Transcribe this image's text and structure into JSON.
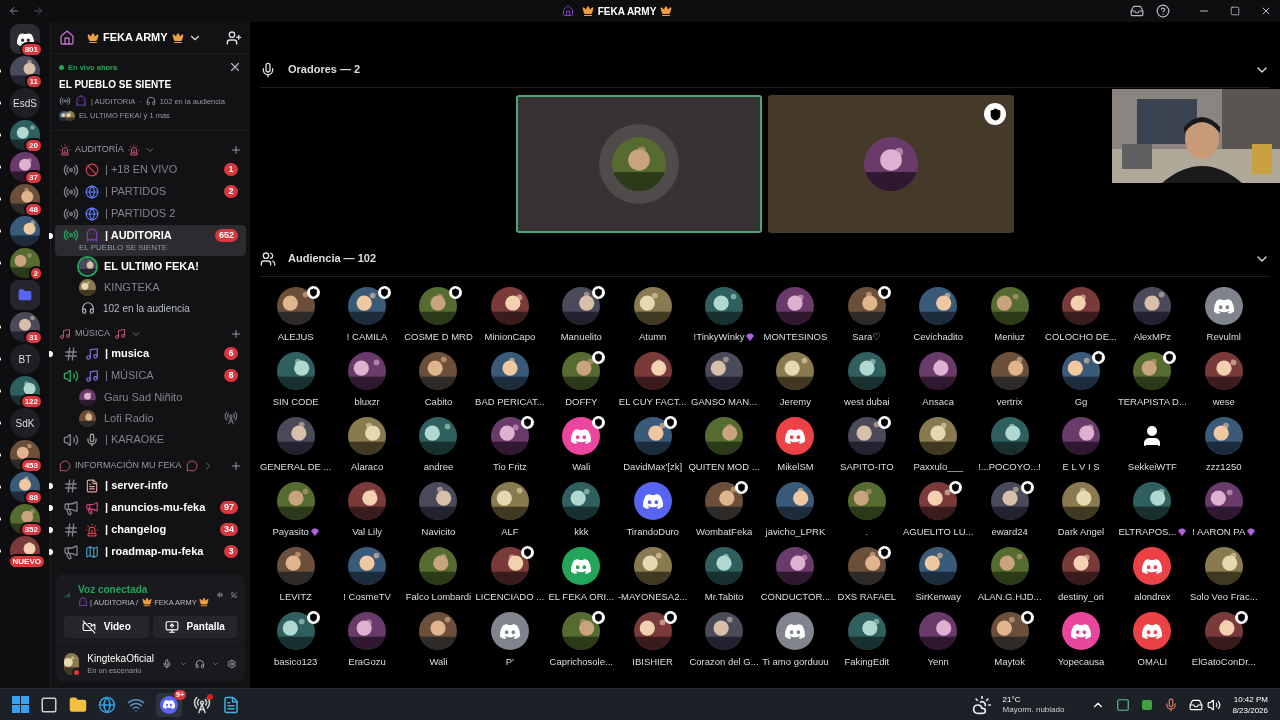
{
  "titlebar": {
    "server_name": "FEKA ARMY"
  },
  "servers": [
    {
      "kind": "discord",
      "badge": "801",
      "unread": false
    },
    {
      "kind": "picture",
      "badge": "11",
      "unread": true
    },
    {
      "kind": "text",
      "label": "EsdS",
      "unread": true
    },
    {
      "kind": "picture",
      "badge": "20",
      "unread": true
    },
    {
      "kind": "picture",
      "badge": "37",
      "unread": true
    },
    {
      "kind": "picture",
      "badge": "48",
      "unread": true
    },
    {
      "kind": "picture",
      "unread": true
    },
    {
      "kind": "picture",
      "badge": "2",
      "unread": true
    },
    {
      "kind": "folder",
      "unread": false
    },
    {
      "kind": "picture",
      "badge": "31",
      "unread": true
    },
    {
      "kind": "text",
      "label": "BT",
      "unread": true
    },
    {
      "kind": "picture",
      "badge": "122",
      "unread": true
    },
    {
      "kind": "text",
      "label": "SdK",
      "unread": true
    },
    {
      "kind": "picture",
      "badge": "453",
      "unread": true
    },
    {
      "kind": "picture",
      "badge": "88",
      "unread": true
    },
    {
      "kind": "picture",
      "badge": "352",
      "unread": true
    },
    {
      "kind": "picture",
      "badge": "NUEVO",
      "unread": true
    }
  ],
  "sidebar": {
    "server_name": "FEKA ARMY",
    "live": {
      "status": "En vivo ahora",
      "title": "EL PUEBLO SE SIENTE",
      "channel": "| AUDITORIA",
      "separator": "·",
      "audience": "102 en la audiencia",
      "speakers": "EL ULTIMO FEKA! y 1 más"
    },
    "categories": [
      {
        "name": "AUDITORÍA",
        "expanded": true,
        "items": [
          {
            "kind": "stage",
            "name": "| +18 EN VIVO",
            "badge": "1",
            "unread": false,
            "selected": false,
            "connected": false
          },
          {
            "kind": "stage",
            "name": "| PARTIDOS",
            "badge": "2",
            "unread": false,
            "selected": false,
            "connected": false
          },
          {
            "kind": "stage",
            "name": "| PARTIDOS 2",
            "unread": false,
            "selected": false,
            "connected": false
          },
          {
            "kind": "stage",
            "name": "| AUDITORIA",
            "badge": "652",
            "subtitle": "EL PUEBLO SE SIENTE",
            "unread": true,
            "selected": true,
            "connected": true
          },
          {
            "kind": "member",
            "name": "EL ULTIMO FEKA!",
            "speaking": true,
            "broadcast_off": false
          },
          {
            "kind": "member",
            "name": "KINGTEKA",
            "speaking": false,
            "broadcast_off": false
          },
          {
            "kind": "audience",
            "name": "102 en la audiencia"
          }
        ]
      },
      {
        "name": "MÚSICA",
        "expanded": true,
        "items": [
          {
            "kind": "text",
            "name": "| musica",
            "badge": "6",
            "unread": true,
            "selected": false,
            "connected": false
          },
          {
            "kind": "voice",
            "name": "| MÚSICA",
            "badge": "8",
            "unread": false,
            "selected": false,
            "connected": true
          },
          {
            "kind": "member",
            "name": "Garu Sad Niñito",
            "speaking": false,
            "broadcast_off": false
          },
          {
            "kind": "member",
            "name": "Lofi Radio",
            "speaking": false,
            "broadcast_off": true
          },
          {
            "kind": "voice",
            "name": "| KARAOKE",
            "unread": false,
            "selected": false,
            "connected": false
          }
        ]
      },
      {
        "name": "INFORMACIÓN MU FEKA",
        "expanded": false,
        "items": [
          {
            "kind": "text",
            "name": "| server-info",
            "unread": true,
            "selected": false,
            "connected": false
          },
          {
            "kind": "announce",
            "name": "| anuncios-mu-feka",
            "badge": "97",
            "unread": true,
            "selected": false,
            "connected": false
          },
          {
            "kind": "text",
            "name": "| changelog",
            "badge": "34",
            "unread": true,
            "selected": false,
            "connected": false
          },
          {
            "kind": "announce",
            "name": "| roadmap-mu-feka",
            "badge": "3",
            "unread": true,
            "selected": false,
            "connected": false
          }
        ]
      }
    ]
  },
  "voice_panel": {
    "status": "Voz conectada",
    "location": "| AUDITORIA / ",
    "server": "FEKA ARMY",
    "buttons": [
      "Video",
      "Pantalla"
    ]
  },
  "user": {
    "name": "KingtekaOficial",
    "status": "En un escenario"
  },
  "main": {
    "speakers_header": "Oradores — 2",
    "speakers": [
      {
        "speaking": true,
        "moderator": false
      },
      {
        "speaking": false,
        "moderator": true
      }
    ],
    "audience_header": "Audiencia — 102",
    "audience": [
      {
        "name": "ALEJUS",
        "kind": "picture",
        "moderator": true,
        "boost": false
      },
      {
        "name": "! CAMILA",
        "kind": "picture",
        "moderator": true,
        "boost": false
      },
      {
        "name": "COSME D MRD",
        "kind": "picture",
        "moderator": true,
        "boost": false
      },
      {
        "name": "MinionCapo",
        "kind": "picture",
        "moderator": false,
        "boost": false
      },
      {
        "name": "Manuelito",
        "kind": "picture",
        "moderator": true,
        "boost": false
      },
      {
        "name": "Atumn",
        "kind": "picture",
        "moderator": false,
        "boost": false
      },
      {
        "name": "!TinkyWinky",
        "kind": "picture",
        "moderator": false,
        "boost": true
      },
      {
        "name": "MONTESINOS",
        "kind": "picture",
        "moderator": false,
        "boost": false
      },
      {
        "name": "Sara♡",
        "kind": "picture",
        "moderator": true,
        "boost": false
      },
      {
        "name": "Cevichadito",
        "kind": "picture",
        "moderator": false,
        "boost": false
      },
      {
        "name": "Meniuz",
        "kind": "picture",
        "moderator": false,
        "boost": false
      },
      {
        "name": "COLOCHO DE...",
        "kind": "picture",
        "moderator": false,
        "boost": false
      },
      {
        "name": "AlexMPz",
        "kind": "picture",
        "moderator": false,
        "boost": false
      },
      {
        "name": "Revulml",
        "kind": "logo",
        "color": "#80848e",
        "moderator": false,
        "boost": false
      },
      {
        "name": "SIN CODE",
        "kind": "picture",
        "moderator": false,
        "boost": false
      },
      {
        "name": "bluxzr",
        "kind": "picture",
        "moderator": false,
        "boost": false
      },
      {
        "name": "Cabito",
        "kind": "picture",
        "moderator": false,
        "boost": false
      },
      {
        "name": "BAD PERICAT...",
        "kind": "picture",
        "moderator": false,
        "boost": false
      },
      {
        "name": "DOFFY",
        "kind": "picture",
        "moderator": true,
        "boost": false
      },
      {
        "name": "EL CUY FACT...",
        "kind": "picture",
        "moderator": false,
        "boost": false
      },
      {
        "name": "GANSO MAN...",
        "kind": "picture",
        "moderator": false,
        "boost": false
      },
      {
        "name": "Jeremy",
        "kind": "picture",
        "moderator": false,
        "boost": false
      },
      {
        "name": "west dubai",
        "kind": "picture",
        "moderator": false,
        "boost": false
      },
      {
        "name": "Ansaca",
        "kind": "picture",
        "moderator": false,
        "boost": false
      },
      {
        "name": "vertrix",
        "kind": "picture",
        "moderator": false,
        "boost": false
      },
      {
        "name": "Gg",
        "kind": "picture",
        "moderator": true,
        "boost": false
      },
      {
        "name": "TERAPISTA D...",
        "kind": "picture",
        "moderator": true,
        "boost": false
      },
      {
        "name": "wese",
        "kind": "picture",
        "moderator": false,
        "boost": false
      },
      {
        "name": "GENERAL DE ...",
        "kind": "picture",
        "moderator": false,
        "boost": false
      },
      {
        "name": "Alaraco",
        "kind": "picture",
        "moderator": false,
        "boost": false
      },
      {
        "name": "andree",
        "kind": "picture",
        "moderator": false,
        "boost": false
      },
      {
        "name": "Tio Fritz",
        "kind": "picture",
        "moderator": true,
        "boost": false
      },
      {
        "name": "Wali",
        "kind": "logo",
        "color": "#eb459e",
        "moderator": true,
        "boost": false
      },
      {
        "name": "DavidMax'[zk]",
        "kind": "picture",
        "moderator": true,
        "boost": false
      },
      {
        "name": "QUITEN MOD ...",
        "kind": "picture",
        "moderator": false,
        "boost": false
      },
      {
        "name": "MikelSM",
        "kind": "logo",
        "color": "#ed4245",
        "moderator": false,
        "boost": false
      },
      {
        "name": "SAPITO-ITO",
        "kind": "picture",
        "moderator": true,
        "boost": false
      },
      {
        "name": "Paxxulo___",
        "kind": "picture",
        "moderator": false,
        "boost": false
      },
      {
        "name": "!...POCOYO...!",
        "kind": "picture",
        "moderator": false,
        "boost": false
      },
      {
        "name": "E L V I S",
        "kind": "picture",
        "moderator": false,
        "boost": false
      },
      {
        "name": "SekkeiWTF",
        "kind": "default",
        "moderator": false,
        "boost": false
      },
      {
        "name": "zzz1250",
        "kind": "picture",
        "moderator": false,
        "boost": false
      },
      {
        "name": "Payasito",
        "kind": "picture",
        "moderator": false,
        "boost": true
      },
      {
        "name": "Val Lily",
        "kind": "picture",
        "moderator": false,
        "boost": false
      },
      {
        "name": "Navicito",
        "kind": "picture",
        "moderator": false,
        "boost": false
      },
      {
        "name": "ALF",
        "kind": "picture",
        "moderator": false,
        "boost": false
      },
      {
        "name": "kkk",
        "kind": "picture",
        "moderator": false,
        "boost": false
      },
      {
        "name": "TirandoDuro",
        "kind": "logo",
        "color": "#5865f2",
        "moderator": false,
        "boost": false
      },
      {
        "name": "WombatFeka",
        "kind": "picture",
        "moderator": true,
        "boost": false
      },
      {
        "name": "javicho_LPRK",
        "kind": "picture",
        "moderator": false,
        "boost": false
      },
      {
        "name": ".",
        "kind": "picture",
        "moderator": false,
        "boost": false
      },
      {
        "name": "AGUELITO LU...",
        "kind": "picture",
        "moderator": true,
        "boost": false
      },
      {
        "name": "eward24",
        "kind": "picture",
        "moderator": true,
        "boost": false
      },
      {
        "name": "Dark Angel",
        "kind": "picture",
        "moderator": false,
        "boost": false
      },
      {
        "name": "ELTRAPOS...",
        "kind": "picture",
        "moderator": false,
        "boost": true
      },
      {
        "name": "! AARON PA",
        "kind": "picture",
        "moderator": false,
        "boost": true
      },
      {
        "name": "LEVITZ",
        "kind": "picture",
        "moderator": false,
        "boost": false
      },
      {
        "name": "! CosmeTV",
        "kind": "picture",
        "moderator": false,
        "boost": false
      },
      {
        "name": "Falco Lombardi",
        "kind": "picture",
        "moderator": false,
        "boost": false
      },
      {
        "name": "LICENCIADO ...",
        "kind": "picture",
        "moderator": true,
        "boost": false
      },
      {
        "name": "EL FEKA ORI...",
        "kind": "logo",
        "color": "#23a55a",
        "moderator": false,
        "boost": false
      },
      {
        "name": "-MAYONESA2...",
        "kind": "picture",
        "moderator": false,
        "boost": false
      },
      {
        "name": "Mr.Tabito",
        "kind": "picture",
        "moderator": false,
        "boost": false
      },
      {
        "name": "CONDUCTOR...",
        "kind": "picture",
        "moderator": false,
        "boost": false
      },
      {
        "name": "DXS RAFAEL",
        "kind": "picture",
        "moderator": true,
        "boost": false
      },
      {
        "name": "SirKenway",
        "kind": "picture",
        "moderator": false,
        "boost": false
      },
      {
        "name": "ALAN.G.HJD...",
        "kind": "picture",
        "moderator": false,
        "boost": false
      },
      {
        "name": "destiny_ori",
        "kind": "picture",
        "moderator": false,
        "boost": false
      },
      {
        "name": "alondrex",
        "kind": "logo",
        "color": "#ed4245",
        "moderator": false,
        "boost": false
      },
      {
        "name": "Solo Veo Frac...",
        "kind": "picture",
        "moderator": false,
        "boost": false
      },
      {
        "name": "basico123",
        "kind": "picture",
        "moderator": true,
        "boost": false
      },
      {
        "name": "EraGozu",
        "kind": "picture",
        "moderator": false,
        "boost": false
      },
      {
        "name": "Wali",
        "kind": "picture",
        "moderator": false,
        "boost": false
      },
      {
        "name": "P'",
        "kind": "logo",
        "color": "#80848e",
        "moderator": false,
        "boost": false
      },
      {
        "name": "Caprichosole...",
        "kind": "picture",
        "moderator": true,
        "boost": false
      },
      {
        "name": "IBISHIER",
        "kind": "picture",
        "moderator": true,
        "boost": false
      },
      {
        "name": "Corazon del G...",
        "kind": "picture",
        "moderator": false,
        "boost": false
      },
      {
        "name": "Ti amo gorduuu",
        "kind": "logo",
        "color": "#80848e",
        "moderator": false,
        "boost": false
      },
      {
        "name": "FakingEdit",
        "kind": "picture",
        "moderator": false,
        "boost": false
      },
      {
        "name": "Yenn",
        "kind": "picture",
        "moderator": false,
        "boost": false
      },
      {
        "name": "Maytok",
        "kind": "picture",
        "moderator": true,
        "boost": false
      },
      {
        "name": "Yopecausa",
        "kind": "logo",
        "color": "#eb459e",
        "moderator": false,
        "boost": false
      },
      {
        "name": "OMALI",
        "kind": "logo",
        "color": "#ed4245",
        "moderator": false,
        "boost": false
      },
      {
        "name": "ElGatoConDr...",
        "kind": "picture",
        "moderator": true,
        "boost": false
      }
    ]
  },
  "taskbar": {
    "discord_badge": "9+",
    "weather": {
      "temp": "21°C",
      "desc": "Mayorm. nublado"
    },
    "time": "10:42 PM",
    "date": "8/23/2026"
  }
}
